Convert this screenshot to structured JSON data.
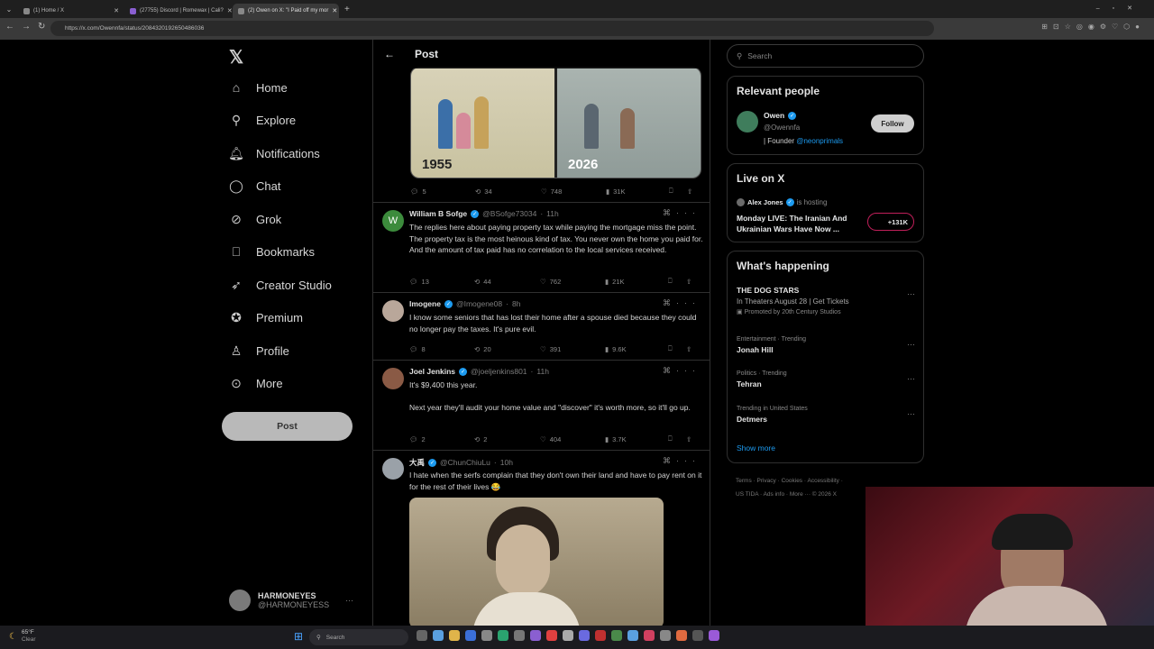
{
  "browser": {
    "tabs": [
      {
        "title": "(1) Home / X",
        "active": false
      },
      {
        "title": "(27755) Discord | Romewax | Cali?",
        "active": false
      },
      {
        "title": "(2) Owen on X: \"I Paid off my mor",
        "active": true
      }
    ],
    "url": "https://x.com/Owennfa/status/2084320192650486036"
  },
  "sidebar": {
    "items": [
      {
        "label": "Home",
        "icon": "home-icon"
      },
      {
        "label": "Explore",
        "icon": "search-icon"
      },
      {
        "label": "Notifications",
        "icon": "bell-icon"
      },
      {
        "label": "Chat",
        "icon": "chat-icon"
      },
      {
        "label": "Grok",
        "icon": "grok-icon"
      },
      {
        "label": "Bookmarks",
        "icon": "bookmark-icon"
      },
      {
        "label": "Creator Studio",
        "icon": "rocket-icon"
      },
      {
        "label": "Premium",
        "icon": "premium-icon"
      },
      {
        "label": "Profile",
        "icon": "person-icon"
      },
      {
        "label": "More",
        "icon": "more-icon"
      }
    ],
    "post_label": "Post",
    "account": {
      "name": "HARMONEYES",
      "handle": "@HARMONEYESS"
    }
  },
  "main": {
    "header": "Post",
    "image": {
      "left_year": "1955",
      "right_year": "2026"
    },
    "post_stats": {
      "replies": "5",
      "reposts": "34",
      "likes": "748",
      "views": "31K"
    },
    "replies": [
      {
        "name": "William B Sofge",
        "handle": "@BSofge73034",
        "time": "11h",
        "avatar_letter": "W",
        "text": "The replies here about paying property tax while paying the mortgage miss the point.  The property tax is the most heinous kind of tax.  You never own the home you paid for.  And the amount of tax paid has no correlation to the local services received.",
        "replies": "13",
        "reposts": "44",
        "likes": "762",
        "views": "21K"
      },
      {
        "name": "Imogene",
        "handle": "@Imogene08",
        "time": "8h",
        "text": "I know some seniors that has lost their home after a spouse died because they could no longer pay the taxes. It's pure evil.",
        "replies": "8",
        "reposts": "20",
        "likes": "391",
        "views": "9.6K"
      },
      {
        "name": "Joel Jenkins",
        "handle": "@joeljenkins801",
        "time": "11h",
        "text": "It's $9,400 this year.",
        "text2": "Next year they'll audit your home value and \"discover\" it's worth more, so it'll go up.",
        "replies": "2",
        "reposts": "2",
        "likes": "404",
        "views": "3.7K"
      },
      {
        "name": "大禹",
        "handle": "@ChunChiuLu",
        "time": "10h",
        "text": "I hate when the serfs complain that they don't own their land and have to pay rent on it for the rest of their lives 😂"
      }
    ]
  },
  "right": {
    "search_placeholder": "Search",
    "relevant": {
      "title": "Relevant people",
      "name": "Owen",
      "handle": "@Owennfa",
      "bio_prefix": "| Founder",
      "bio_link": "@neonprimals",
      "follow": "Follow"
    },
    "live": {
      "title": "Live on X",
      "host": "Alex Jones",
      "hosting": "is hosting",
      "text": "Monday LIVE: The Iranian And Ukrainian Wars Have Now ...",
      "count": "+131K"
    },
    "happening": {
      "title": "What's happening",
      "items": [
        {
          "category": "",
          "title": "THE DOG STARS",
          "sub": "In Theaters August 28 | Get Tickets",
          "promo": "Promoted by 20th Century Studios"
        },
        {
          "category": "Entertainment · Trending",
          "title": "Jonah Hill"
        },
        {
          "category": "Politics · Trending",
          "title": "Tehran"
        },
        {
          "category": "Trending in United States",
          "title": "Detmers"
        }
      ],
      "show_more": "Show more"
    },
    "footer": [
      "Terms",
      "Privacy",
      "Cookies",
      "Accessibility",
      "US TIDA",
      "Ads info",
      "More ···",
      "© 2026 X"
    ]
  },
  "taskbar": {
    "weather_temp": "65°F",
    "weather_desc": "Clear",
    "search": "Search"
  }
}
